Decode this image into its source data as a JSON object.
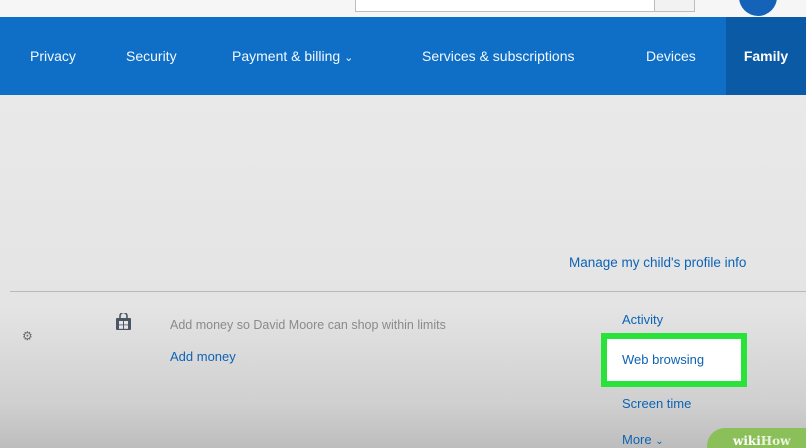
{
  "nav": {
    "items": [
      {
        "label": "Privacy"
      },
      {
        "label": "Security"
      },
      {
        "label": "Payment & billing",
        "has_dropdown": true
      },
      {
        "label": "Services & subscriptions"
      },
      {
        "label": "Devices"
      },
      {
        "label": "Family",
        "active": true
      }
    ]
  },
  "main": {
    "manage_profile_link": "Manage my child's profile info",
    "allowance": {
      "icon": "windows-store-icon",
      "description": "Add money so David Moore can shop within limits",
      "add_money_link": "Add money"
    },
    "side_links": {
      "activity": "Activity",
      "web_browsing": "Web browsing",
      "screen_time": "Screen time",
      "more": "More"
    }
  },
  "watermark": {
    "part1": "wiki",
    "part2": "How"
  },
  "colors": {
    "nav_bg": "#0f6fc6",
    "nav_active_bg": "#0b5aa6",
    "link": "#0d63b6",
    "highlight": "#29e33a"
  }
}
